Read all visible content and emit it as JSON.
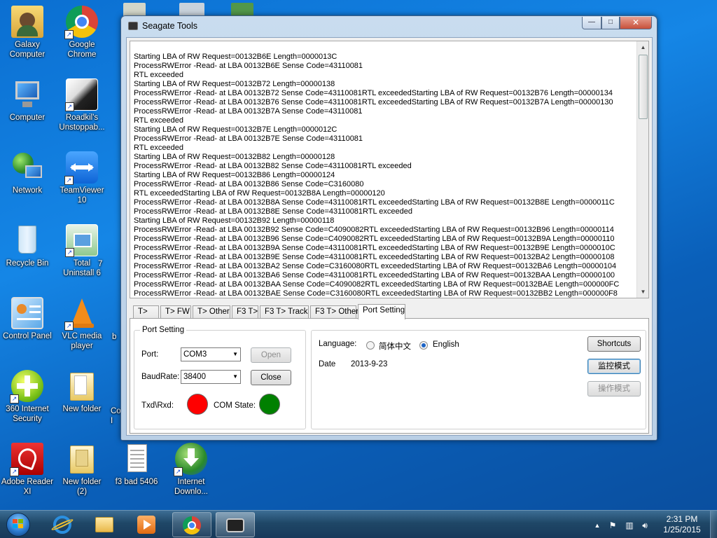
{
  "desktop": {
    "icons": [
      {
        "label": "Galaxy\nComputer",
        "icon": "user-folder-icon"
      },
      {
        "label": "Google\nChrome",
        "icon": "chrome-icon"
      },
      {
        "label": "Computer",
        "icon": "computer-icon"
      },
      {
        "label": "Roadkil's\nUnstoppab...",
        "icon": "cat-photo-icon"
      },
      {
        "label": "Network",
        "icon": "network-icon"
      },
      {
        "label": "TeamViewer\n10",
        "icon": "teamviewer-icon"
      },
      {
        "label": "Recycle Bin",
        "icon": "recycle-bin-icon"
      },
      {
        "label": "Total\nUninstall 6",
        "icon": "uninstall-icon"
      },
      {
        "label": "Control Panel",
        "icon": "control-panel-icon"
      },
      {
        "label": "VLC media\nplayer",
        "icon": "vlc-icon"
      },
      {
        "label": "360 Internet\nSecurity",
        "icon": "security-plus-icon"
      },
      {
        "label": "New folder",
        "icon": "folder-icon"
      },
      {
        "label": "Adobe Reader\nXI",
        "icon": "adobe-reader-icon"
      },
      {
        "label": "New folder\n(2)",
        "icon": "folder-icon"
      },
      {
        "label": "f3 bad 5406",
        "icon": "text-file-icon"
      },
      {
        "label": "Internet\nDownlo...",
        "icon": "download-manager-icon"
      }
    ],
    "partial_labels": {
      "p1": "7",
      "p2": "b",
      "p3": "Co\nI"
    }
  },
  "window": {
    "title": "Seagate Tools",
    "controls": {
      "minimize": "—",
      "maximize": "□",
      "close": "✕"
    },
    "log_lines": [
      "Starting LBA of RW Request=00132B6E  Length=0000013C",
      "ProcessRWError -Read-   at LBA 00132B6E  Sense Code=43110081",
      "RTL exceeded",
      "Starting LBA of RW Request=00132B72  Length=00000138",
      "ProcessRWError -Read-   at LBA 00132B72  Sense Code=43110081RTL exceededStarting LBA of RW Request=00132B76  Length=00000134",
      "ProcessRWError -Read-   at LBA 00132B76  Sense Code=43110081RTL exceededStarting LBA of RW Request=00132B7A  Length=00000130",
      "ProcessRWError -Read-   at LBA 00132B7A  Sense Code=43110081",
      "RTL exceeded",
      "Starting LBA of RW Request=00132B7E  Length=0000012C",
      "ProcessRWError -Read-   at LBA 00132B7E  Sense Code=43110081",
      "RTL exceeded",
      "Starting LBA of RW Request=00132B82  Length=00000128",
      "ProcessRWError -Read-   at LBA 00132B82  Sense Code=43110081RTL exceeded",
      "Starting LBA of RW Request=00132B86  Length=00000124",
      "ProcessRWError -Read-   at LBA 00132B86  Sense Code=C3160080",
      "RTL exceededStarting LBA of RW Request=00132B8A  Length=00000120",
      "ProcessRWError -Read-   at LBA 00132B8A  Sense Code=43110081RTL exceededStarting LBA of RW Request=00132B8E  Length=0000011C",
      "ProcessRWError -Read-   at LBA 00132B8E  Sense Code=43110081RTL exceeded",
      "Starting LBA of RW Request=00132B92  Length=00000118",
      "ProcessRWError -Read-   at LBA 00132B92  Sense Code=C4090082RTL exceededStarting LBA of RW Request=00132B96  Length=00000114",
      "ProcessRWError -Read-   at LBA 00132B96  Sense Code=C4090082RTL exceededStarting LBA of RW Request=00132B9A  Length=00000110",
      "ProcessRWError -Read-   at LBA 00132B9A  Sense Code=43110081RTL exceededStarting LBA of RW Request=00132B9E  Length=0000010C",
      "ProcessRWError -Read-   at LBA 00132B9E  Sense Code=43110081RTL exceededStarting LBA of RW Request=00132BA2  Length=00000108",
      "ProcessRWError -Read-   at LBA 00132BA2  Sense Code=C3160080RTL exceededStarting LBA of RW Request=00132BA6  Length=00000104",
      "ProcessRWError -Read-   at LBA 00132BA6  Sense Code=43110081RTL exceededStarting LBA of RW Request=00132BAA  Length=00000100",
      "ProcessRWError -Read-   at LBA 00132BAA  Sense Code=C4090082RTL exceededStarting LBA of RW Request=00132BAE  Length=000000FC",
      "ProcessRWError -Read-   at LBA 00132BAE  Sense Code=C3160080RTL exceededStarting LBA of RW Request=00132BB2  Length=000000F8"
    ],
    "tabs": [
      "T>",
      "T> FW",
      "T> Other",
      "F3 T>",
      "F3 T> Track",
      "F3 T> Other",
      "Port Setting"
    ],
    "active_tab": "Port Setting",
    "port_setting": {
      "group_title": "Port Setting",
      "port_label": "Port:",
      "port_value": "COM3",
      "baud_label": "BaudRate:",
      "baud_value": "38400",
      "open_label": "Open",
      "close_label": "Close",
      "txd_label": "Txd\\Rxd:",
      "com_state_label": "COM State:",
      "txd_color": "#ff0000",
      "com_state_color": "#008000"
    },
    "language": {
      "label": "Language:",
      "option_chinese": "简体中文",
      "option_english": "English",
      "selected": "English",
      "date_label": "Date",
      "date_value": "2013-9-23"
    },
    "buttons": {
      "shortcuts": "Shortcuts",
      "monitor_mode": "监控模式",
      "operate_mode": "操作模式"
    }
  },
  "taskbar": {
    "apps": [
      "windows-explorer",
      "internet-explorer",
      "file-explorer",
      "media-player",
      "google-chrome",
      "seagate-tools"
    ],
    "clock_time": "2:31 PM",
    "clock_date": "1/25/2015"
  }
}
